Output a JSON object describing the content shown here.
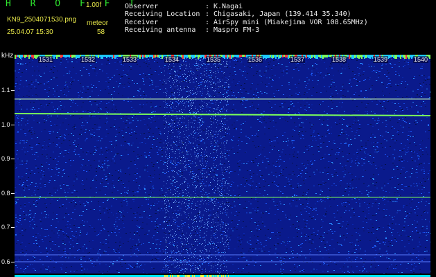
{
  "header": {
    "app_title": "H R O F F T",
    "version": "1.00f",
    "filename": "KN9_2504071530.png",
    "meteor_label": "meteor",
    "datetime": "25.04.07 15:30",
    "meteor_count": "58"
  },
  "station_info": [
    {
      "key": "Observer",
      "value": "K.Nagai"
    },
    {
      "key": "Receiving Location",
      "value": "Chigasaki, Japan (139.414 35.340)"
    },
    {
      "key": "Receiver",
      "value": "AirSpy mini (Miakejima VOR 108.65MHz)"
    },
    {
      "key": "Receiving antenna",
      "value": "Maspro FM-3"
    }
  ],
  "separator": ":",
  "plot": {
    "unit_label": "kHz",
    "freq_ticks": [
      "1.1",
      "1.0",
      "0.9",
      "0.8",
      "0.7",
      "0.6"
    ],
    "time_ticks": [
      "1531",
      "1532",
      "1533",
      "1534",
      "1535",
      "1536",
      "1537",
      "1538",
      "1539",
      "1540"
    ]
  },
  "colors": {
    "background": "#000000",
    "noise_low": "#0a1a8c",
    "noise_high": "#2f7dff",
    "trace": "#7cff5a",
    "strip": "#00e5ff",
    "strip_burst": "#ffff33"
  }
}
